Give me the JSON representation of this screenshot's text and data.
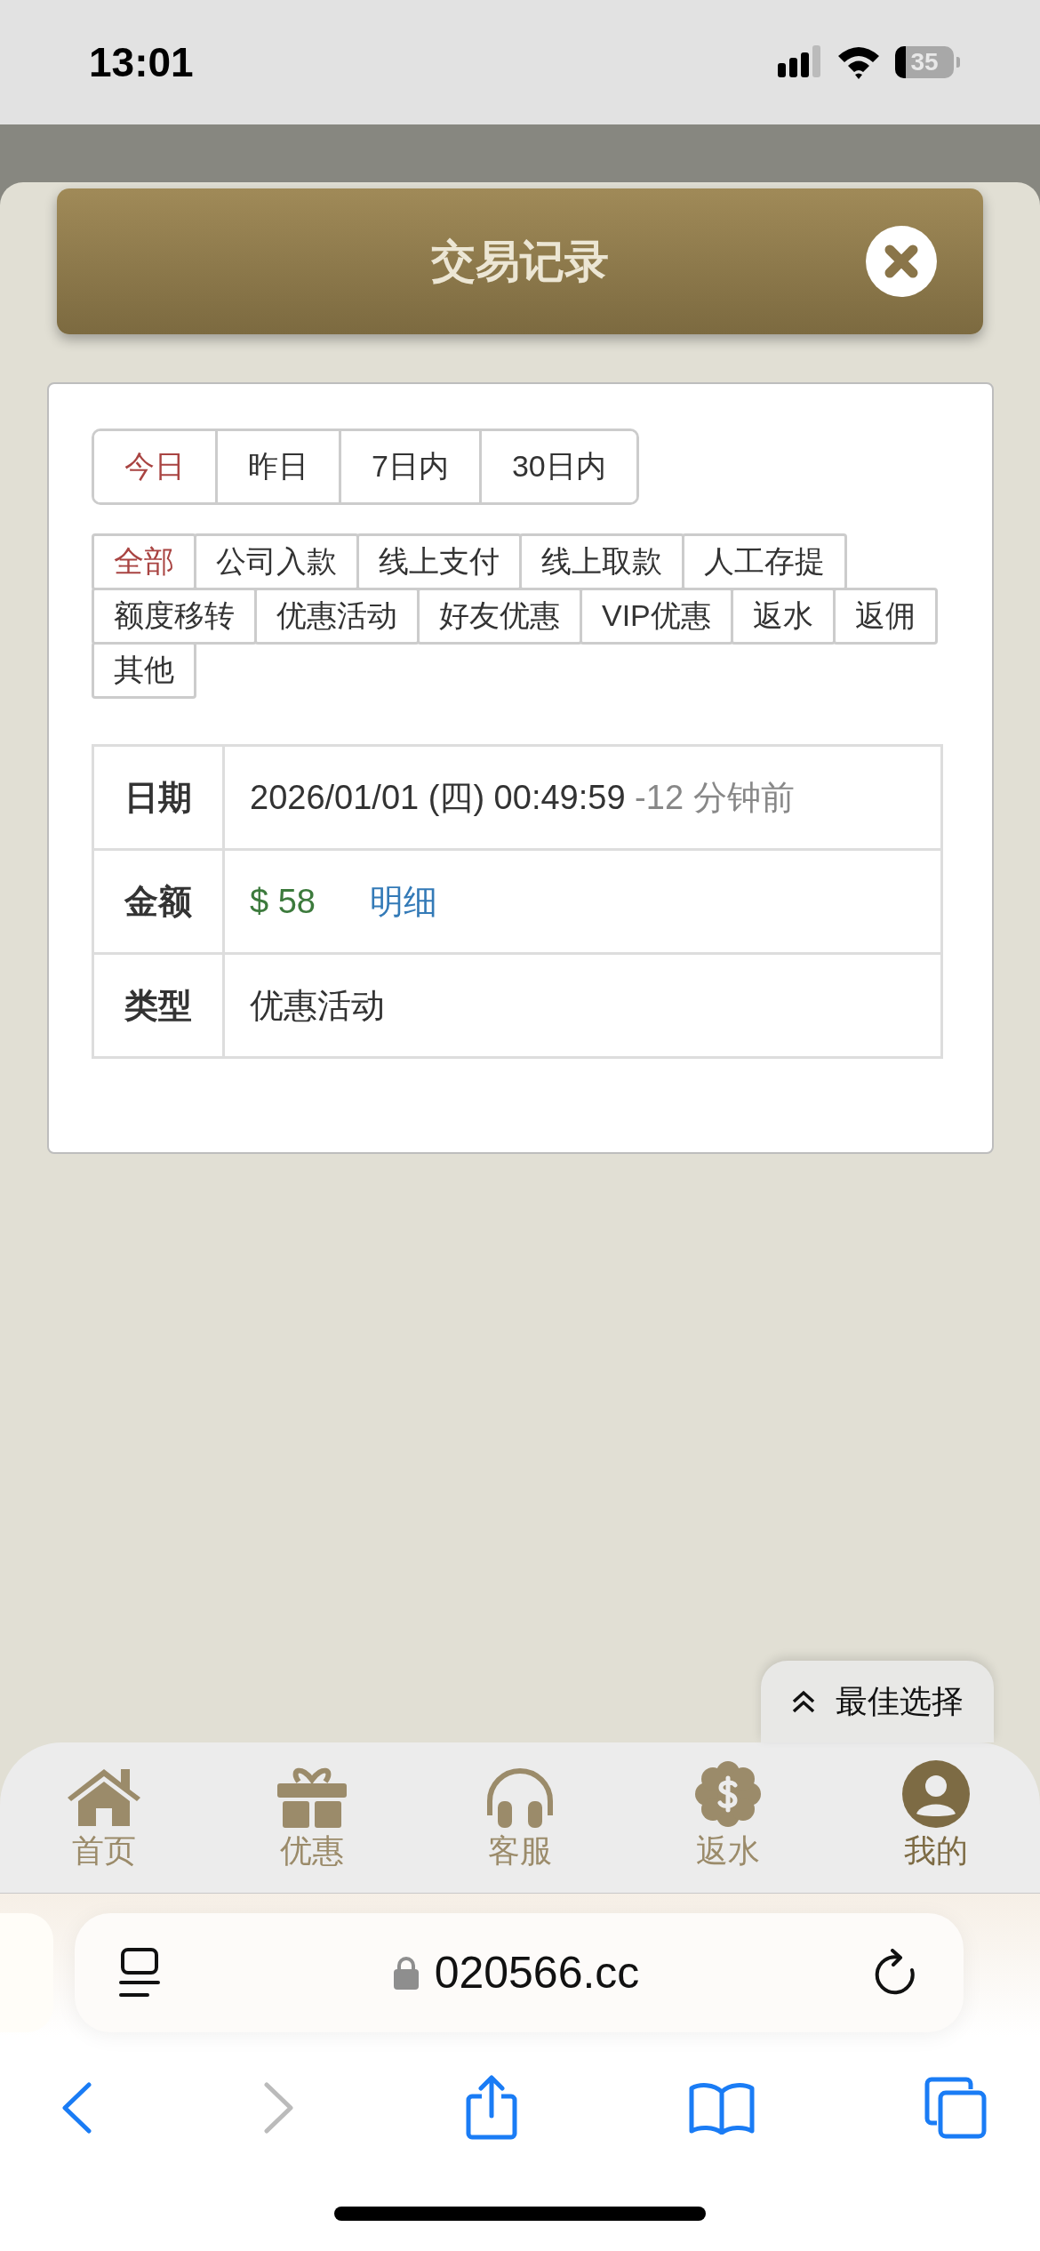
{
  "status_bar": {
    "time": "13:01",
    "battery": "35"
  },
  "dialog": {
    "title": "交易记录"
  },
  "date_tabs": [
    {
      "label": "今日",
      "selected": true
    },
    {
      "label": "昨日",
      "selected": false
    },
    {
      "label": "7日内",
      "selected": false
    },
    {
      "label": "30日内",
      "selected": false
    }
  ],
  "type_filters": [
    {
      "label": "全部",
      "selected": true
    },
    {
      "label": "公司入款",
      "selected": false
    },
    {
      "label": "线上支付",
      "selected": false
    },
    {
      "label": "线上取款",
      "selected": false
    },
    {
      "label": "人工存提",
      "selected": false
    },
    {
      "label": "额度移转",
      "selected": false
    },
    {
      "label": "优惠活动",
      "selected": false
    },
    {
      "label": "好友优惠",
      "selected": false
    },
    {
      "label": "VIP优惠",
      "selected": false
    },
    {
      "label": "返水",
      "selected": false
    },
    {
      "label": "返佣",
      "selected": false
    },
    {
      "label": "其他",
      "selected": false
    }
  ],
  "record": {
    "rows": [
      {
        "kind": "date",
        "label": "日期",
        "value": "2026/01/01 (四) 00:49:59",
        "suffix": "-12 分钟前"
      },
      {
        "kind": "amount",
        "label": "金额",
        "value": "$ 58",
        "link": "明细"
      },
      {
        "kind": "text",
        "label": "类型",
        "value": "优惠活动"
      }
    ]
  },
  "float_button": {
    "label": "最佳选择"
  },
  "bottom_nav": [
    {
      "label": "首页",
      "kind": "home",
      "selected": false
    },
    {
      "label": "优惠",
      "kind": "gift",
      "selected": false
    },
    {
      "label": "客服",
      "kind": "headset",
      "selected": false
    },
    {
      "label": "返水",
      "kind": "rebate",
      "selected": false
    },
    {
      "label": "我的",
      "kind": "user",
      "selected": true
    }
  ],
  "browser": {
    "url": "020566.cc"
  }
}
